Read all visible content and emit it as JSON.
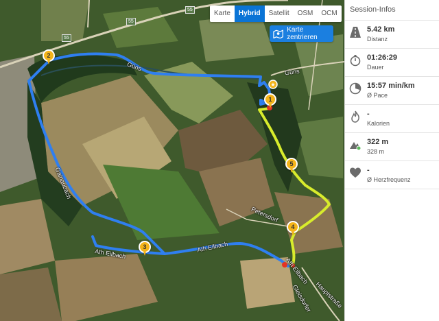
{
  "map": {
    "map_types": [
      {
        "label": "Karte",
        "active": false
      },
      {
        "label": "Hybrid",
        "active": true
      },
      {
        "label": "Satellit",
        "active": false
      },
      {
        "label": "OSM",
        "active": false
      },
      {
        "label": "OCM",
        "active": false
      }
    ],
    "center_button": {
      "label": "Karte zentrieren"
    },
    "road_labels": {
      "guns_1": "Güns",
      "guns_2": "Güns",
      "gainaubach": "Gainaubach",
      "ath_eilbach_1": "Ath Eilbach",
      "ath_eilbach_2": "Ath Eilbach",
      "ath_eilbach_3": "Ath Eilbach",
      "petersdorf": "Petersdorf",
      "hauptstrasse": "Hauptstraße",
      "gleisdorf": "Gleisdorfer",
      "route_55_a": "55",
      "route_55_b": "55",
      "route_55_c": "55"
    },
    "km_markers": [
      "1",
      "2",
      "3",
      "4",
      "5"
    ],
    "colors": {
      "route_blue": "#2f7ff0",
      "route_yellow": "#e5ee2a",
      "marker": "#f4b41a",
      "start_red": "#e63322"
    }
  },
  "panel": {
    "title": "Session-Infos",
    "stats": [
      {
        "icon": "road-icon",
        "value": "5.42 km",
        "label": "Distanz"
      },
      {
        "icon": "stopwatch-icon",
        "value": "01:26:29",
        "label": "Dauer"
      },
      {
        "icon": "pace-gauge-icon",
        "value": "15:57 min/km",
        "label": "Ø Pace"
      },
      {
        "icon": "flame-icon",
        "value": "-",
        "label": "Kalorien"
      },
      {
        "icon": "elevation-icon",
        "value": "322 m",
        "label": "328 m"
      },
      {
        "icon": "heart-icon",
        "value": "-",
        "label": "Ø Herzfrequenz"
      }
    ]
  }
}
